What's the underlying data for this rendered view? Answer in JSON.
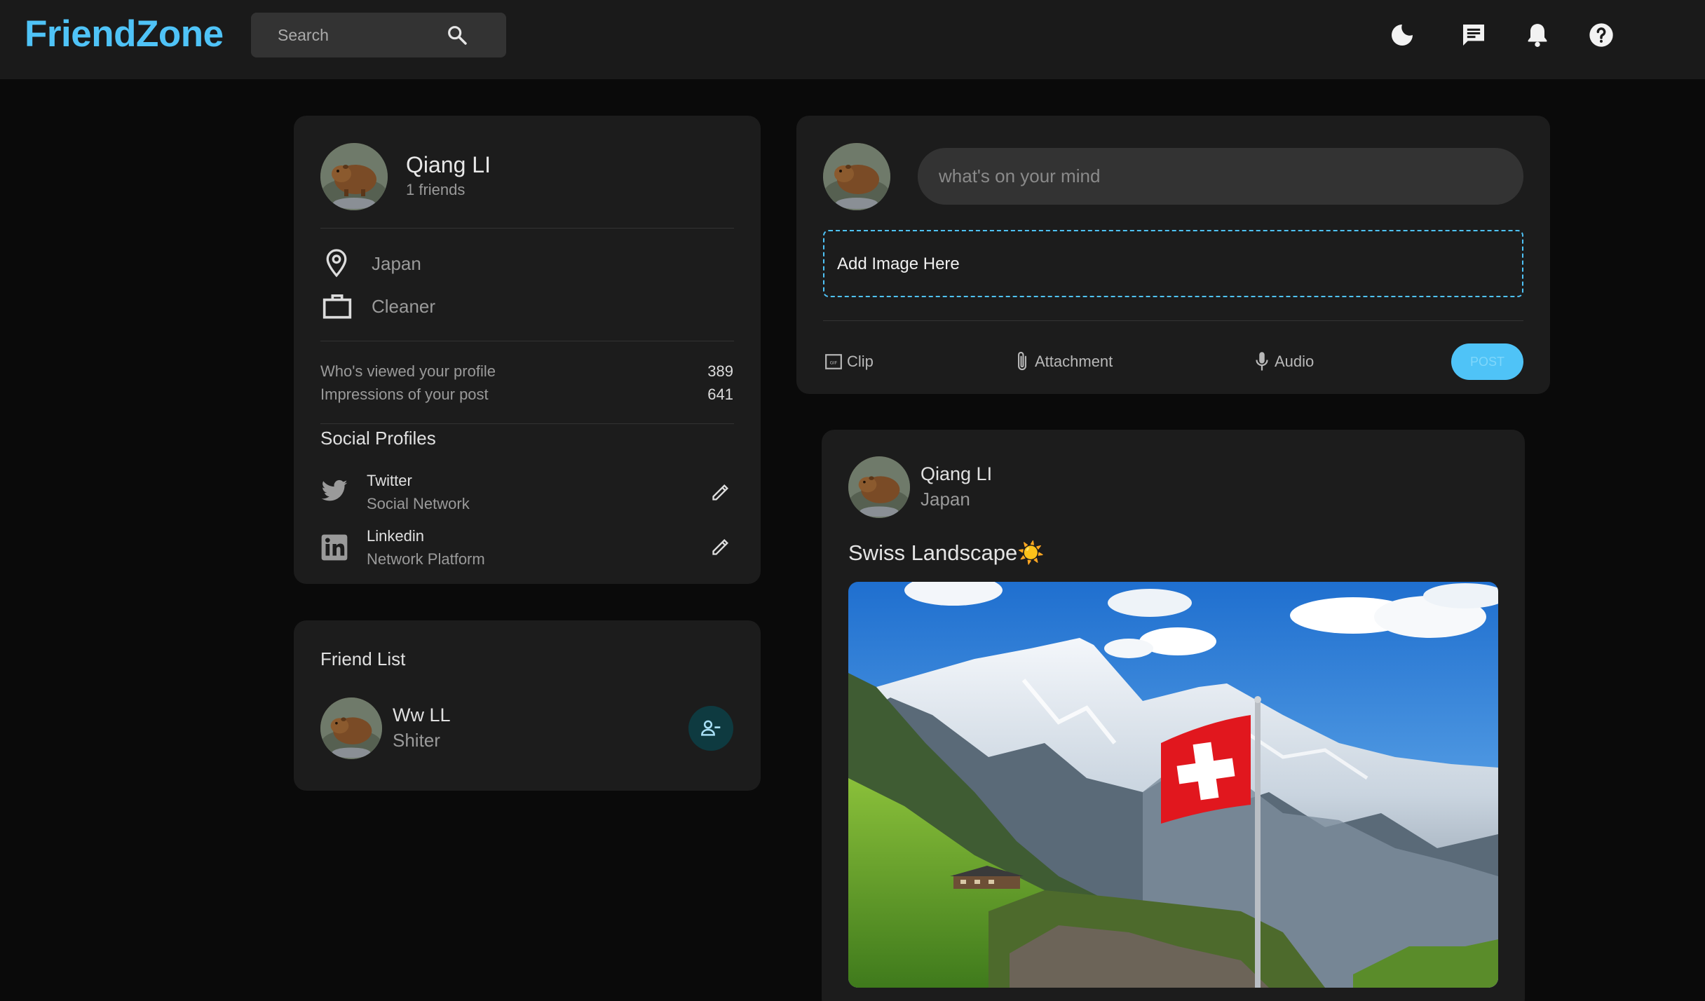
{
  "navbar": {
    "logo": "FriendZone",
    "search_placeholder": "Search",
    "icons": [
      "search-icon",
      "dark-mode-icon",
      "message-icon",
      "notifications-icon",
      "help-icon"
    ]
  },
  "profile": {
    "name": "Qiang LI",
    "friends_count": "1 friends",
    "location": "Japan",
    "occupation": "Cleaner",
    "stats": [
      {
        "label": "Who's viewed your profile",
        "value": "389"
      },
      {
        "label": "Impressions of your post",
        "value": "641"
      }
    ],
    "social_title": "Social Profiles",
    "socials": [
      {
        "name": "Twitter",
        "sub": "Social Network",
        "icon": "twitter-icon"
      },
      {
        "name": "Linkedin",
        "sub": "Network Platform",
        "icon": "linkedin-icon"
      }
    ]
  },
  "friend_list": {
    "title": "Friend List",
    "friends": [
      {
        "name": "Ww LL",
        "occupation": "Shiter"
      }
    ]
  },
  "composer": {
    "placeholder": "what's on your mind",
    "dropzone_label": "Add Image Here",
    "tools": [
      {
        "label": "Clip",
        "icon": "gif-icon"
      },
      {
        "label": "Attachment",
        "icon": "attachment-icon"
      },
      {
        "label": "Audio",
        "icon": "microphone-icon"
      }
    ],
    "post_label": "POST"
  },
  "post": {
    "author": "Qiang LI",
    "location": "Japan",
    "caption": "Swiss Landscape☀️"
  },
  "colors": {
    "accent": "#4fc3f7",
    "background": "#0a0a0a",
    "card": "#1c1c1c",
    "navbar": "#1a1a1a"
  }
}
